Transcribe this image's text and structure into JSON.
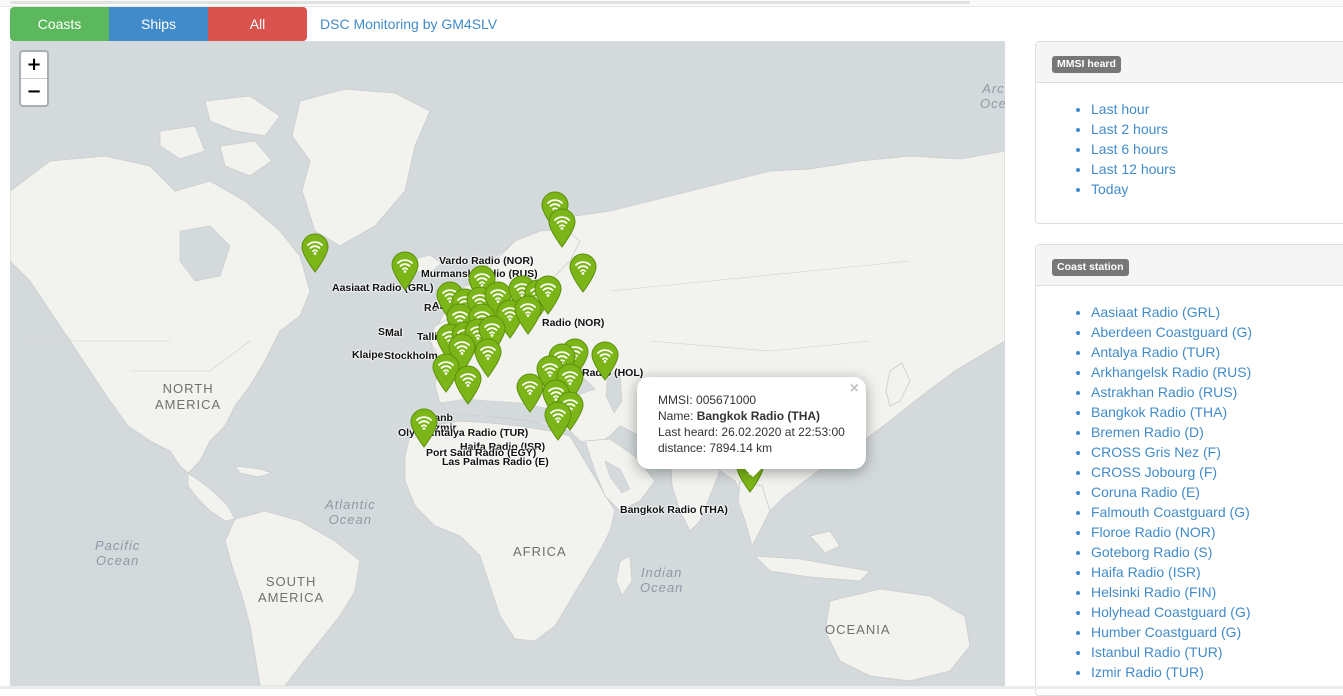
{
  "nav": {
    "coasts_label": "Coasts",
    "ships_label": "Ships",
    "all_label": "All",
    "brand": "DSC Monitoring by GM4SLV"
  },
  "map": {
    "zoom_in": "+",
    "zoom_out": "−",
    "regions": {
      "north_america_1": "NORTH",
      "north_america_2": "AMERICA",
      "south_america_1": "SOUTH",
      "south_america_2": "AMERICA",
      "africa": "AFRICA",
      "oceania": "OCEANIA"
    },
    "oceans": {
      "atlantic_1": "Atlantic",
      "atlantic_2": "Ocean",
      "pacific_1": "Pacific",
      "pacific_2": "Ocean",
      "indian_1": "Indian",
      "indian_2": "Ocean",
      "arctic_1": "Arc",
      "arctic_2": "Oce"
    },
    "labels": {
      "vardo": "Vardo Radio (NOR)",
      "murmansk": "Murmansk Radio (RUS)",
      "aasiaat": "Aasiaat Radio (GRL)",
      "reykjavik": "Re",
      "arkhangelsk": "Arkhan",
      "floroe": "Radio (NOR)",
      "sat": "Sat",
      "mal": "Mal",
      "tallinn": "Tallin",
      "klaipeda": "Klaipe",
      "stockholm": "Stockholm",
      "holland": "Radio (HOL)",
      "istanbul": "Istanb",
      "izmir": "Izmir",
      "antalya": "Olym  Antalya Radio (TUR)",
      "haifa": "Haifa Radio (ISR)",
      "port_said": "Port Said Radio (EGY)",
      "las_palmas": "Las Palmas Radio (E)",
      "bangkok": "Bangkok Radio (THA)"
    },
    "colors": {
      "marker": "#7cb518",
      "marker_dark": "#5c8f0b",
      "land": "#f2f2ef",
      "water": "#d4dadc"
    },
    "icon": "wifi-icon"
  },
  "popup": {
    "mmsi_label": "MMSI:",
    "mmsi": "005671000",
    "name_label": "Name:",
    "name": "Bangkok Radio (THA)",
    "last_heard_label": "Last heard:",
    "last_heard": "26.02.2020 at 22:53:00",
    "distance_label": "distance:",
    "distance": "7894.14 km",
    "close": "×"
  },
  "mmsi_panel": {
    "title": "MMSI heard",
    "items": [
      "Last hour",
      "Last 2 hours",
      "Last 6 hours",
      "Last 12 hours",
      "Today"
    ]
  },
  "coast_panel": {
    "title": "Coast station",
    "items": [
      "Aasiaat Radio (GRL)",
      "Aberdeen Coastguard (G)",
      "Antalya Radio (TUR)",
      "Arkhangelsk Radio (RUS)",
      "Astrakhan Radio (RUS)",
      "Bangkok Radio (THA)",
      "Bremen Radio (D)",
      "CROSS Gris Nez (F)",
      "CROSS Jobourg (F)",
      "Coruna Radio (E)",
      "Falmouth Coastguard (G)",
      "Floroe Radio (NOR)",
      "Goteborg Radio (S)",
      "Haifa Radio (ISR)",
      "Helsinki Radio (FIN)",
      "Holyhead Coastguard (G)",
      "Humber Coastguard (G)",
      "Istanbul Radio (TUR)",
      "Izmir Radio (TUR)"
    ]
  }
}
